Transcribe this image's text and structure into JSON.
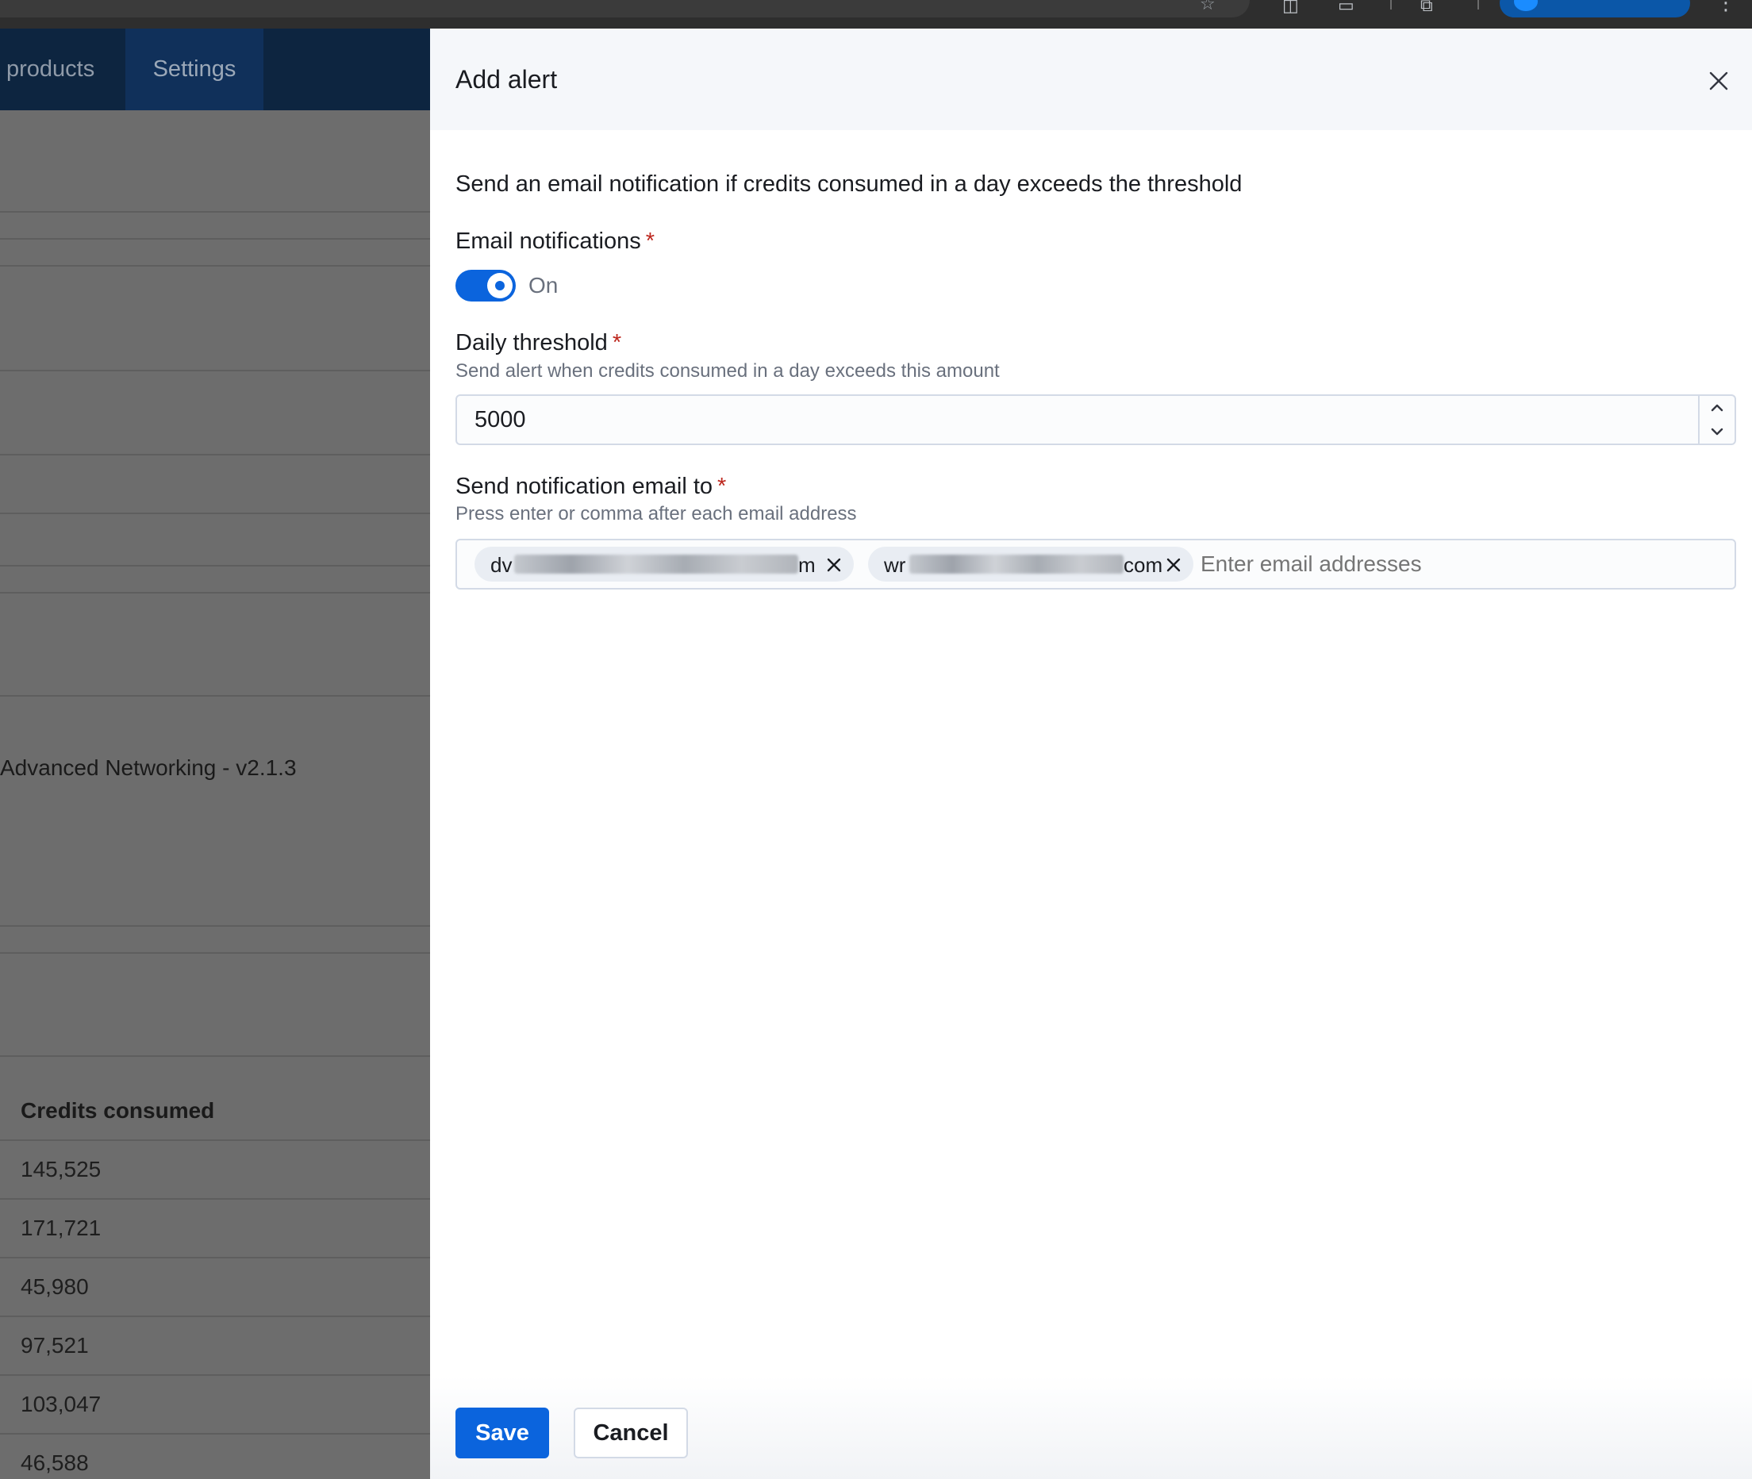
{
  "background_app": {
    "nav_tabs": [
      "products",
      "Settings"
    ],
    "row_text": "Advanced Networking - v2.1.3",
    "table": {
      "header": "Credits consumed",
      "rows": [
        "145,525",
        "171,721",
        "45,980",
        "97,521",
        "103,047",
        "46,588"
      ]
    }
  },
  "flyout": {
    "title": "Add alert",
    "description": "Send an email notification if credits consumed in a day exceeds the threshold",
    "email_notifications": {
      "label": "Email notifications",
      "required_mark": "*",
      "toggle_state": "On"
    },
    "daily_threshold": {
      "label": "Daily threshold",
      "required_mark": "*",
      "help": "Send alert when credits consumed in a day exceeds this amount",
      "value": "5000"
    },
    "send_to": {
      "label": "Send notification email to",
      "required_mark": "*",
      "help": "Press enter or comma after each email address",
      "chips": [
        {
          "prefix": "dv",
          "suffix": "m"
        },
        {
          "prefix": "wr",
          "suffix": "com"
        }
      ],
      "placeholder": "Enter email addresses"
    },
    "buttons": {
      "save": "Save",
      "cancel": "Cancel"
    }
  },
  "colors": {
    "primary": "#0b64dd",
    "required": "#bd271e",
    "header_bg": "#f5f7fa",
    "overlay_bg": "#6d6d6d",
    "nav_bg": "#0d2540"
  },
  "icons": [
    "close-icon",
    "chevron-up-icon",
    "chevron-down-icon",
    "remove-chip-icon",
    "star-icon",
    "extension-icon",
    "menu-kebab-icon"
  ]
}
